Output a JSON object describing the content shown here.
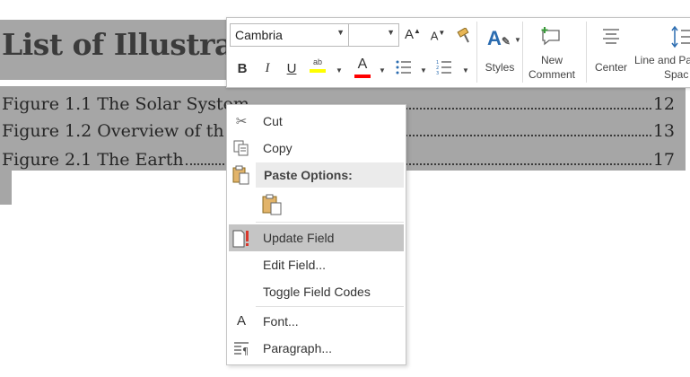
{
  "document": {
    "title": "List of Illustra",
    "entries": [
      {
        "label": "Figure 1.1 The Solar System",
        "page": "12"
      },
      {
        "label": "Figure 1.2 Overview of th",
        "page": "13"
      },
      {
        "label": "Figure 2.1 The Earth",
        "page": "17"
      }
    ]
  },
  "toolbar": {
    "font_name": "Cambria",
    "font_size": "",
    "styles_label": "Styles",
    "new_comment_label": [
      "New",
      "Comment"
    ],
    "center_label": "Center",
    "line_spacing_label": [
      "Line and Pa",
      "Spac"
    ],
    "colors": {
      "highlight": "#ffff00",
      "font_color": "#ff0000"
    }
  },
  "menu": {
    "cut": "Cut",
    "copy": "Copy",
    "paste_options": "Paste Options:",
    "update_field": "Update Field",
    "edit_field": "Edit Field...",
    "toggle_field_codes": "Toggle Field Codes",
    "font": "Font...",
    "paragraph": "Paragraph..."
  }
}
